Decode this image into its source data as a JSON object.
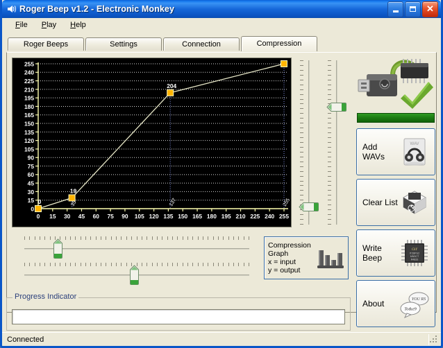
{
  "window": {
    "title": "Roger Beep v1.2 - Electronic Monkey",
    "icon": "speaker-icon",
    "minimize_label": "Minimize",
    "maximize_label": "Maximize",
    "close_label": "Close"
  },
  "menu": {
    "items": [
      {
        "label": "File",
        "accel": "F",
        "rest": "ile"
      },
      {
        "label": "Play",
        "accel": "P",
        "rest": "lay"
      },
      {
        "label": "Help",
        "accel": "H",
        "rest": "elp"
      }
    ]
  },
  "tabs": [
    {
      "label": "Roger Beeps",
      "active": false
    },
    {
      "label": "Settings",
      "active": false
    },
    {
      "label": "Connection",
      "active": false
    },
    {
      "label": "Compression",
      "active": true
    }
  ],
  "legend": {
    "line1": "Compression",
    "line2": "Graph",
    "line3": "x = input",
    "line4": "y = output",
    "icon": "bar-chart-icon"
  },
  "right_panel": {
    "device_icon": "usb-chip-ok-icon",
    "status_bar_color": "#1c7a12",
    "buttons": [
      {
        "label": "Add WAVs",
        "icon": "wav-headphones-icon"
      },
      {
        "label": "Clear List",
        "icon": "recycle-bin-icon"
      },
      {
        "label": "Write Beep",
        "icon": "microchip-icon"
      },
      {
        "label": "About",
        "icon": "speech-bubbles-icon"
      }
    ]
  },
  "progress": {
    "group_label": "Progress Indicator",
    "value": 0
  },
  "statusbar": {
    "text": "Connected"
  },
  "sliders": {
    "vertical": [
      {
        "name": "vertical-slider-left",
        "value_pct": 8
      },
      {
        "name": "vertical-slider-right",
        "value_pct": 73
      }
    ],
    "horizontal": [
      {
        "name": "horizontal-slider-top",
        "value_pct": 14
      },
      {
        "name": "horizontal-slider-bottom",
        "value_pct": 49
      }
    ]
  },
  "chart_data": {
    "type": "line",
    "title": "Compression Graph",
    "xlabel": "x = input",
    "ylabel": "y = output",
    "xlim": [
      0,
      255
    ],
    "ylim": [
      0,
      255
    ],
    "xticks": [
      0,
      15,
      30,
      45,
      60,
      75,
      90,
      105,
      120,
      135,
      150,
      165,
      180,
      195,
      210,
      225,
      240,
      255
    ],
    "yticks": [
      0,
      15,
      30,
      45,
      60,
      75,
      90,
      105,
      120,
      135,
      150,
      165,
      180,
      195,
      210,
      225,
      240,
      255
    ],
    "grid": true,
    "background": "#000000",
    "line_color": "#e8e8c8",
    "marker_color": "#ffb400",
    "axis_color": "#ffffb0",
    "points": [
      {
        "x": 0,
        "y": 0,
        "label": "0"
      },
      {
        "x": 35,
        "y": 19,
        "label": "19"
      },
      {
        "x": 137,
        "y": 204,
        "label": "204"
      },
      {
        "x": 255,
        "y": 255,
        "label": ""
      }
    ],
    "point_x_labels": [
      "0",
      "35",
      "137",
      "255"
    ],
    "series": [
      {
        "name": "compression-curve",
        "x": [
          0,
          35,
          137,
          255
        ],
        "values": [
          0,
          19,
          204,
          255
        ]
      }
    ]
  }
}
